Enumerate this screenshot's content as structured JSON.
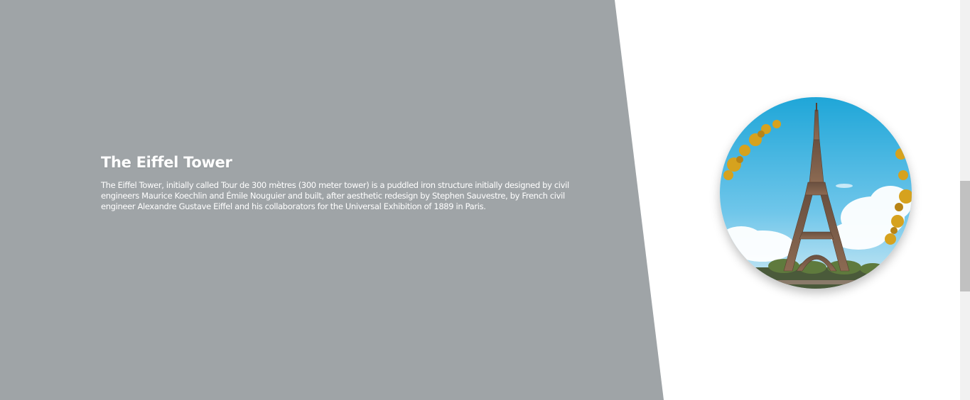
{
  "section": {
    "title": "The Eiffel Tower",
    "description": "The Eiffel Tower, initially called Tour de 300 mètres (300 meter tower) is a puddled iron structure initially designed by civil engineers Maurice Koechlin and Émile Nouguier and built, after aesthetic redesign by Stephen Sauvestre, by French civil engineer Alexandre Gustave Eiffel and his collaborators for the Universal Exhibition of 1889 in Paris."
  },
  "image": {
    "subject": "eiffel-tower-photo"
  },
  "colors": {
    "panel": "#9fa4a7",
    "background": "#ffffff",
    "text": "#ffffff"
  }
}
